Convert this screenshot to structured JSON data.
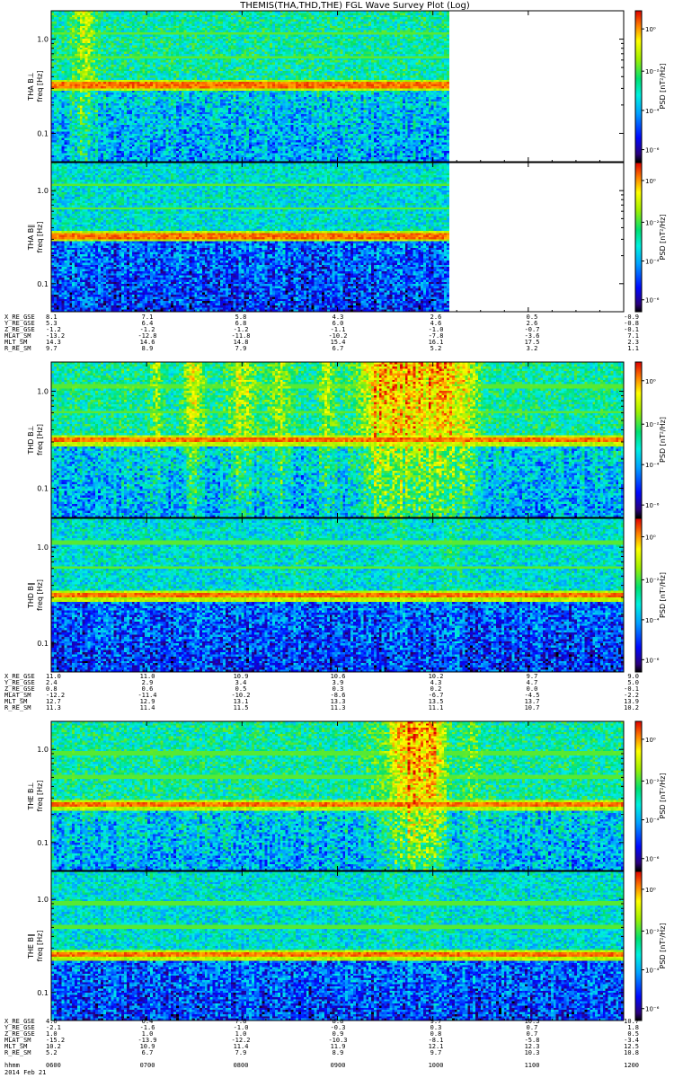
{
  "title": "THEMIS(THA,THD,THE) FGL Wave Survey Plot (Log)",
  "colorbar": {
    "label": "PSD [nT²/Hz]",
    "tick_labels": [
      "10⁰",
      "10⁻²",
      "10⁻⁴",
      "10⁻⁶"
    ]
  },
  "freq_axis": {
    "label": "freq [Hz]",
    "tick_labels": [
      "1.0",
      "0.1"
    ]
  },
  "orbit_labels": [
    "X_RE_GSE",
    "Y_RE_GSE",
    "Z_RE_GSE",
    "MLAT_SM",
    "MLT_SM",
    "R_RE_SM"
  ],
  "time_row": {
    "label": "hhmm",
    "values": [
      "0600",
      "0700",
      "0800",
      "0900",
      "1000",
      "1100",
      "1200"
    ]
  },
  "date_label": "2014 Feb 21",
  "chart_data": [
    {
      "type": "heatmap",
      "probe": "THA",
      "component": "B⊥",
      "panel_label": "THA B⊥",
      "ylabel": "freq [Hz]",
      "y_scale": "log",
      "ylim": [
        0.05,
        2.0
      ],
      "x": [
        "0600",
        "0700",
        "0800",
        "0900",
        "1000",
        "1100",
        "1200"
      ],
      "data_end": "1010",
      "band_hz": 0.33,
      "colorbar_range": [
        1e-06,
        1
      ]
    },
    {
      "type": "heatmap",
      "probe": "THA",
      "component": "B∥",
      "panel_label": "THA B∥",
      "ylabel": "freq [Hz]",
      "y_scale": "log",
      "ylim": [
        0.05,
        2.0
      ],
      "x": [
        "0600",
        "0700",
        "0800",
        "0900",
        "1000",
        "1100",
        "1200"
      ],
      "data_end": "1010",
      "band_hz": 0.33,
      "colorbar_range": [
        1e-06,
        1
      ]
    },
    {
      "type": "heatmap",
      "probe": "THD",
      "component": "B⊥",
      "panel_label": "THD B⊥",
      "ylabel": "freq [Hz]",
      "y_scale": "log",
      "ylim": [
        0.05,
        2.0
      ],
      "x": [
        "0600",
        "0700",
        "0800",
        "0900",
        "1000",
        "1100",
        "1200"
      ],
      "band_hz": 0.32,
      "colorbar_range": [
        1e-06,
        1
      ]
    },
    {
      "type": "heatmap",
      "probe": "THD",
      "component": "B∥",
      "panel_label": "THD B∥",
      "ylabel": "freq [Hz]",
      "y_scale": "log",
      "ylim": [
        0.05,
        2.0
      ],
      "x": [
        "0600",
        "0700",
        "0800",
        "0900",
        "1000",
        "1100",
        "1200"
      ],
      "band_hz": 0.32,
      "colorbar_range": [
        1e-06,
        1
      ]
    },
    {
      "type": "heatmap",
      "probe": "THE",
      "component": "B⊥",
      "panel_label": "THE B⊥",
      "ylabel": "freq [Hz]",
      "y_scale": "log",
      "ylim": [
        0.05,
        2.0
      ],
      "x": [
        "0600",
        "0700",
        "0800",
        "0900",
        "1000",
        "1100",
        "1200"
      ],
      "band_hz": 0.26,
      "colorbar_range": [
        1e-06,
        1
      ]
    },
    {
      "type": "heatmap",
      "probe": "THE",
      "component": "B∥",
      "panel_label": "THE B∥",
      "ylabel": "freq [Hz]",
      "y_scale": "log",
      "ylim": [
        0.05,
        2.0
      ],
      "x": [
        "0600",
        "0700",
        "0800",
        "0900",
        "1000",
        "1100",
        "1200"
      ],
      "band_hz": 0.26,
      "colorbar_range": [
        1e-06,
        1
      ]
    }
  ],
  "orbit_tables": [
    {
      "probe": "THA",
      "rows": [
        [
          "8.1",
          "7.1",
          "5.8",
          "4.3",
          "2.6",
          "0.5",
          "-0.9"
        ],
        [
          "5.3",
          "6.4",
          "6.8",
          "6.0",
          "4.6",
          "2.6",
          "-0.8"
        ],
        [
          "-1.2",
          "-1.2",
          "-1.2",
          "-1.1",
          "-1.0",
          "-0.7",
          "-0.1"
        ],
        [
          "-13.2",
          "-12.8",
          "-11.8",
          "-10.2",
          "-7.8",
          "-3.6",
          "7.1"
        ],
        [
          "14.3",
          "14.6",
          "14.8",
          "15.4",
          "16.1",
          "17.5",
          "2.3"
        ],
        [
          "9.7",
          "8.9",
          "7.9",
          "6.7",
          "5.2",
          "3.2",
          "1.1"
        ]
      ]
    },
    {
      "probe": "THD",
      "rows": [
        [
          "11.0",
          "11.0",
          "10.9",
          "10.6",
          "10.2",
          "9.7",
          "9.0"
        ],
        [
          "2.4",
          "2.9",
          "3.4",
          "3.9",
          "4.3",
          "4.7",
          "5.0"
        ],
        [
          "0.8",
          "0.6",
          "0.5",
          "0.3",
          "0.2",
          "0.0",
          "-0.1"
        ],
        [
          "-12.2",
          "-11.4",
          "-10.2",
          "-8.6",
          "-6.7",
          "-4.5",
          "-2.2"
        ],
        [
          "12.7",
          "12.9",
          "13.1",
          "13.3",
          "13.5",
          "13.7",
          "13.9"
        ],
        [
          "11.3",
          "11.4",
          "11.5",
          "11.3",
          "11.1",
          "10.7",
          "10.2"
        ]
      ]
    },
    {
      "probe": "THE",
      "rows": [
        [
          "4.6",
          "6.4",
          "7.8",
          "8.8",
          "9.7",
          "10.3",
          "10.7"
        ],
        [
          "-2.1",
          "-1.6",
          "-1.0",
          "-0.3",
          "0.3",
          "0.7",
          "1.8"
        ],
        [
          "1.0",
          "1.0",
          "1.0",
          "0.9",
          "0.8",
          "0.7",
          "0.5"
        ],
        [
          "-15.2",
          "-13.9",
          "-12.2",
          "-10.3",
          "-8.1",
          "-5.8",
          "-3.4"
        ],
        [
          "10.2",
          "10.9",
          "11.4",
          "11.9",
          "12.1",
          "12.3",
          "12.5"
        ],
        [
          "5.2",
          "6.7",
          "7.9",
          "8.9",
          "9.7",
          "10.3",
          "10.8"
        ]
      ]
    }
  ],
  "colors": {
    "axis": "#000000",
    "background": "#ffffff",
    "no_data": "#ffffff"
  }
}
